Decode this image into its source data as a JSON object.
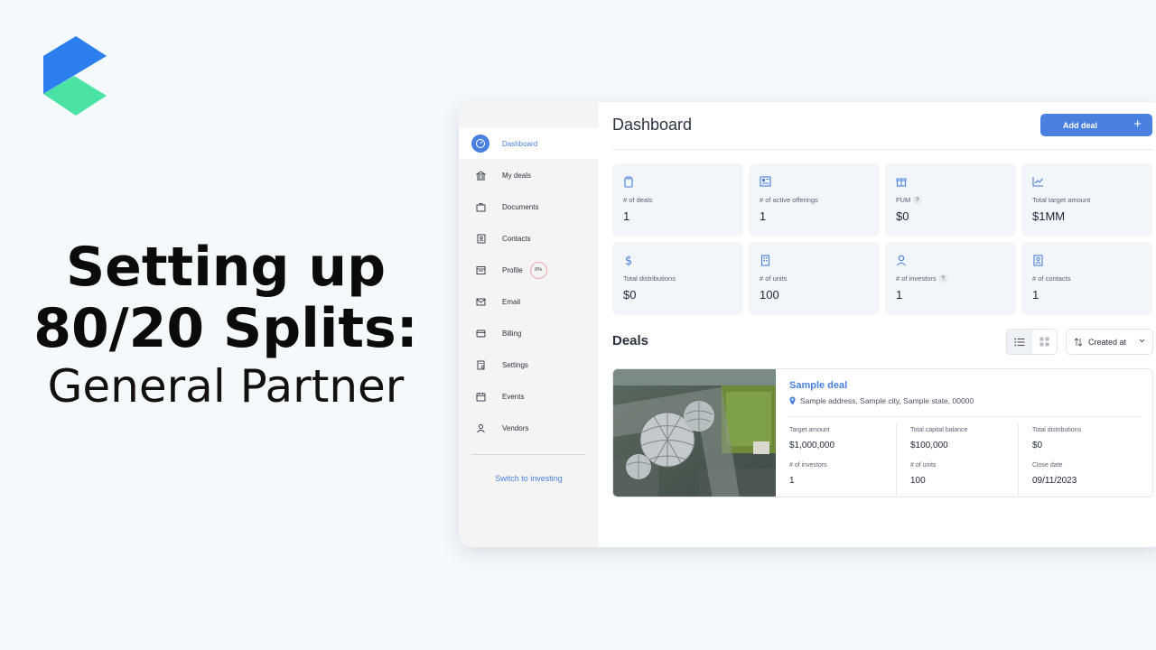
{
  "headline": {
    "line1": "Setting up",
    "line2": "80/20 Splits:",
    "line3": "General Partner"
  },
  "sidebar": {
    "items": [
      {
        "label": "Dashboard",
        "icon": "gauge-icon",
        "active": true
      },
      {
        "label": "My deals",
        "icon": "bank-icon"
      },
      {
        "label": "Documents",
        "icon": "briefcase-icon"
      },
      {
        "label": "Contacts",
        "icon": "contact-book-icon"
      },
      {
        "label": "Profile",
        "icon": "profile-card-icon",
        "badge": "0%"
      },
      {
        "label": "Email",
        "icon": "mail-icon"
      },
      {
        "label": "Billing",
        "icon": "credit-card-icon"
      },
      {
        "label": "Settings",
        "icon": "settings-doc-icon"
      },
      {
        "label": "Events",
        "icon": "calendar-icon"
      },
      {
        "label": "Vendors",
        "icon": "vendor-icon"
      }
    ],
    "switch_label": "Switch to investing"
  },
  "header": {
    "title": "Dashboard",
    "add_label": "Add deal",
    "add_icon": "+"
  },
  "stats": [
    {
      "label": "# of deals",
      "value": "1",
      "icon": "clipboard-icon"
    },
    {
      "label": "# of active offerings",
      "value": "1",
      "icon": "newspaper-icon"
    },
    {
      "label": "FUM",
      "value": "$0",
      "icon": "gift-box-icon",
      "help": "?"
    },
    {
      "label": "Total target amount",
      "value": "$1MM",
      "icon": "trend-chart-icon"
    },
    {
      "label": "Total distributions",
      "value": "$0",
      "icon": "dollar-icon"
    },
    {
      "label": "# of units",
      "value": "100",
      "icon": "building-icon"
    },
    {
      "label": "# of investors",
      "value": "1",
      "icon": "person-icon",
      "help": "?"
    },
    {
      "label": "# of contacts",
      "value": "1",
      "icon": "contact-card-icon"
    }
  ],
  "deals": {
    "title": "Deals",
    "sort_label": "Created at",
    "card": {
      "name": "Sample deal",
      "address": "Sample address, Sample city, Sample state, 00000",
      "fields": [
        {
          "label": "Target amount",
          "value": "$1,000,000"
        },
        {
          "label": "Total capital balance",
          "value": "$100,000"
        },
        {
          "label": "Total distributions",
          "value": "$0"
        },
        {
          "label": "# of investors",
          "value": "1"
        },
        {
          "label": "# of units",
          "value": "100"
        },
        {
          "label": "Close date",
          "value": "09/11/2023"
        }
      ]
    }
  },
  "colors": {
    "accent": "#4a80e0",
    "logo_blue": "#2d7ff0",
    "logo_green": "#4be3a4",
    "badge_ring": "#f0a7a7"
  }
}
